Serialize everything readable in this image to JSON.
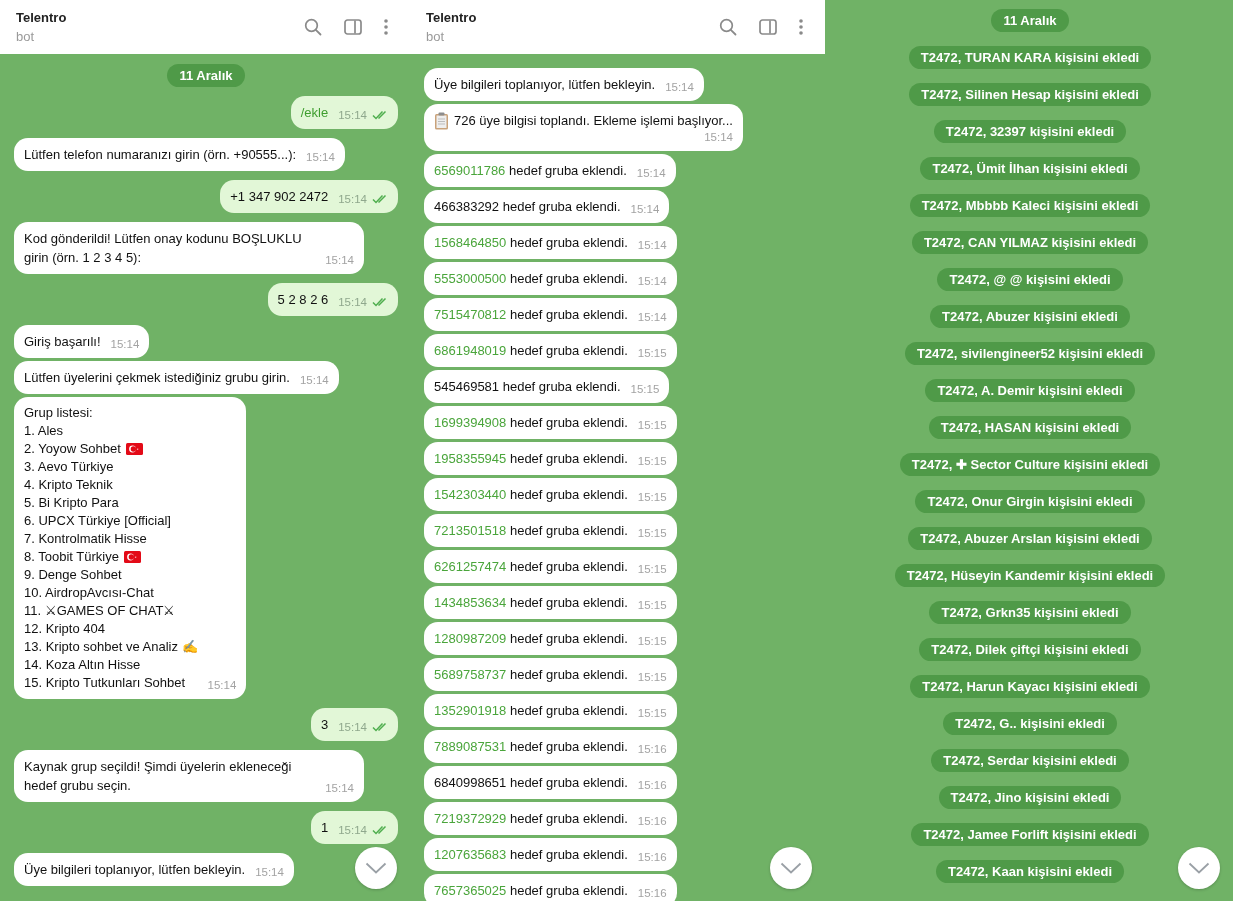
{
  "panels": [
    {
      "header": {
        "title": "Telentro",
        "subtitle": "bot"
      },
      "date": "11 Aralık",
      "messages": [
        {
          "kind": "outgoing",
          "text": "/ekle",
          "time": "15:14",
          "read": true,
          "command": true
        },
        {
          "kind": "incoming",
          "text": "Lütfen telefon numaranızı girin (örn. +90555...):",
          "time": "15:14"
        },
        {
          "kind": "outgoing",
          "text": "+1 347 902 2472",
          "time": "15:14",
          "read": true,
          "command": false
        },
        {
          "kind": "incoming",
          "text": "Kod gönderildi! Lütfen onay kodunu BOŞLUKLU girin (örn. 1 2 3 4 5):",
          "time": "15:14"
        },
        {
          "kind": "outgoing",
          "text": "5 2 8 2 6",
          "time": "15:14",
          "read": true,
          "command": false
        },
        {
          "kind": "incoming",
          "text": "Giriş başarılı!",
          "time": "15:14"
        },
        {
          "kind": "incoming",
          "text": "Lütfen üyelerini çekmek istediğiniz grubu girin.",
          "time": "15:14"
        },
        {
          "kind": "list",
          "title": "Grup listesi:",
          "time": "15:14",
          "items": [
            {
              "text": "1. Ales",
              "flag": false
            },
            {
              "text": "2. Yoyow Sohbet",
              "flag": true
            },
            {
              "text": "3. Aevo Türkiye",
              "flag": false
            },
            {
              "text": "4. Kripto Teknik",
              "flag": false
            },
            {
              "text": "5. Bi Kripto Para",
              "flag": false
            },
            {
              "text": "6. UPCX Türkiye [Official]",
              "flag": false
            },
            {
              "text": "7. Kontrolmatik Hisse",
              "flag": false
            },
            {
              "text": "8. Toobit Türkiye",
              "flag": true
            },
            {
              "text": "9. Denge Sohbet",
              "flag": false
            },
            {
              "text": "10. AirdropAvcısı-Chat",
              "flag": false
            },
            {
              "text": "11. ⚔GAMES OF CHAT⚔",
              "flag": false
            },
            {
              "text": "12. Kripto 404",
              "flag": false
            },
            {
              "text": "13. Kripto sohbet ve Analiz ✍",
              "flag": false
            },
            {
              "text": "14. Koza Altın Hisse",
              "flag": false
            },
            {
              "text": "15. Kripto Tutkunları Sohbet",
              "flag": false
            }
          ]
        },
        {
          "kind": "outgoing",
          "text": "3",
          "time": "15:14",
          "read": true,
          "command": false
        },
        {
          "kind": "incoming",
          "text": "Kaynak grup seçildi! Şimdi üyelerin ekleneceği hedef grubu seçin.",
          "time": "15:14"
        },
        {
          "kind": "outgoing",
          "text": "1",
          "time": "15:14",
          "read": true,
          "command": false
        },
        {
          "kind": "incoming",
          "text": "Üye bilgileri toplanıyor, lütfen bekleyin.",
          "time": "15:14"
        }
      ]
    },
    {
      "header": {
        "title": "Telentro",
        "subtitle": "bot"
      },
      "messages": [
        {
          "kind": "incoming",
          "text": "Üye bilgileri toplanıyor, lütfen bekleyin.",
          "time": "15:14"
        },
        {
          "kind": "clipboard",
          "text": "726 üye bilgisi toplandı. Ekleme işlemi başlıyor...",
          "time": "15:14"
        },
        {
          "kind": "added",
          "number": "6569011786",
          "linked": true,
          "text": "hedef gruba eklendi.",
          "time": "15:14"
        },
        {
          "kind": "added",
          "number": "466383292",
          "linked": false,
          "text": "hedef gruba eklendi.",
          "time": "15:14"
        },
        {
          "kind": "added",
          "number": "1568464850",
          "linked": true,
          "text": "hedef gruba eklendi.",
          "time": "15:14"
        },
        {
          "kind": "added",
          "number": "5553000500",
          "linked": true,
          "text": "hedef gruba eklendi.",
          "time": "15:14"
        },
        {
          "kind": "added",
          "number": "7515470812",
          "linked": true,
          "text": "hedef gruba eklendi.",
          "time": "15:14"
        },
        {
          "kind": "added",
          "number": "6861948019",
          "linked": true,
          "text": "hedef gruba eklendi.",
          "time": "15:15"
        },
        {
          "kind": "added",
          "number": "545469581",
          "linked": false,
          "text": "hedef gruba eklendi.",
          "time": "15:15"
        },
        {
          "kind": "added",
          "number": "1699394908",
          "linked": true,
          "text": "hedef gruba eklendi.",
          "time": "15:15"
        },
        {
          "kind": "added",
          "number": "1958355945",
          "linked": true,
          "text": "hedef gruba eklendi.",
          "time": "15:15"
        },
        {
          "kind": "added",
          "number": "1542303440",
          "linked": true,
          "text": "hedef gruba eklendi.",
          "time": "15:15"
        },
        {
          "kind": "added",
          "number": "7213501518",
          "linked": true,
          "text": "hedef gruba eklendi.",
          "time": "15:15"
        },
        {
          "kind": "added",
          "number": "6261257474",
          "linked": true,
          "text": "hedef gruba eklendi.",
          "time": "15:15"
        },
        {
          "kind": "added",
          "number": "1434853634",
          "linked": true,
          "text": "hedef gruba eklendi.",
          "time": "15:15"
        },
        {
          "kind": "added",
          "number": "1280987209",
          "linked": true,
          "text": "hedef gruba eklendi.",
          "time": "15:15"
        },
        {
          "kind": "added",
          "number": "5689758737",
          "linked": true,
          "text": "hedef gruba eklendi.",
          "time": "15:15"
        },
        {
          "kind": "added",
          "number": "1352901918",
          "linked": true,
          "text": "hedef gruba eklendi.",
          "time": "15:15"
        },
        {
          "kind": "added",
          "number": "7889087531",
          "linked": true,
          "text": "hedef gruba eklendi.",
          "time": "15:16"
        },
        {
          "kind": "added",
          "number": "6840998651",
          "linked": false,
          "text": "hedef gruba eklendi.",
          "time": "15:16"
        },
        {
          "kind": "added",
          "number": "7219372929",
          "linked": true,
          "text": "hedef gruba eklendi.",
          "time": "15:16"
        },
        {
          "kind": "added",
          "number": "1207635683",
          "linked": true,
          "text": "hedef gruba eklendi.",
          "time": "15:16"
        },
        {
          "kind": "added",
          "number": "7657365025",
          "linked": true,
          "text": "hedef gruba eklendi.",
          "time": "15:16"
        }
      ]
    },
    {
      "date": "11 Aralık",
      "messages": [
        {
          "kind": "service",
          "text": "T2472, TURAN KARA kişisini ekledi"
        },
        {
          "kind": "service",
          "text": "T2472, Silinen Hesap kişisini ekledi"
        },
        {
          "kind": "service",
          "text": "T2472, 32397 kişisini ekledi"
        },
        {
          "kind": "service",
          "text": "T2472, Ümit İlhan kişisini ekledi"
        },
        {
          "kind": "service",
          "text": "T2472, Mbbbb Kaleci kişisini ekledi"
        },
        {
          "kind": "service",
          "text": "T2472, CAN YILMAZ kişisini ekledi"
        },
        {
          "kind": "service",
          "text": "T2472, @ @ kişisini ekledi"
        },
        {
          "kind": "service",
          "text": "T2472, Abuzer kişisini ekledi"
        },
        {
          "kind": "service",
          "text": "T2472, sivilengineer52 kişisini ekledi"
        },
        {
          "kind": "service",
          "text": "T2472, A. Demir kişisini ekledi"
        },
        {
          "kind": "service",
          "text": "T2472, HASAN kişisini ekledi"
        },
        {
          "kind": "service",
          "text": "T2472, ✚ Sector Culture kişisini ekledi"
        },
        {
          "kind": "service",
          "text": "T2472, Onur Girgin kişisini ekledi"
        },
        {
          "kind": "service",
          "text": "T2472, Abuzer Arslan kişisini ekledi"
        },
        {
          "kind": "service",
          "text": "T2472, Hüseyin Kandemir kişisini ekledi"
        },
        {
          "kind": "service",
          "text": "T2472, Grkn35 kişisini ekledi"
        },
        {
          "kind": "service",
          "text": "T2472, Dilek çiftçi kişisini ekledi"
        },
        {
          "kind": "service",
          "text": "T2472, Harun Kayacı kişisini ekledi"
        },
        {
          "kind": "service",
          "text": "T2472, G.. kişisini ekledi"
        },
        {
          "kind": "service",
          "text": "T2472, Serdar kişisini ekledi"
        },
        {
          "kind": "service",
          "text": "T2472, Jino kişisini ekledi"
        },
        {
          "kind": "service",
          "text": "T2472, Jamee Forlift kişisini ekledi"
        },
        {
          "kind": "service",
          "text": "T2472, Kaan kişisini ekledi"
        }
      ]
    }
  ]
}
